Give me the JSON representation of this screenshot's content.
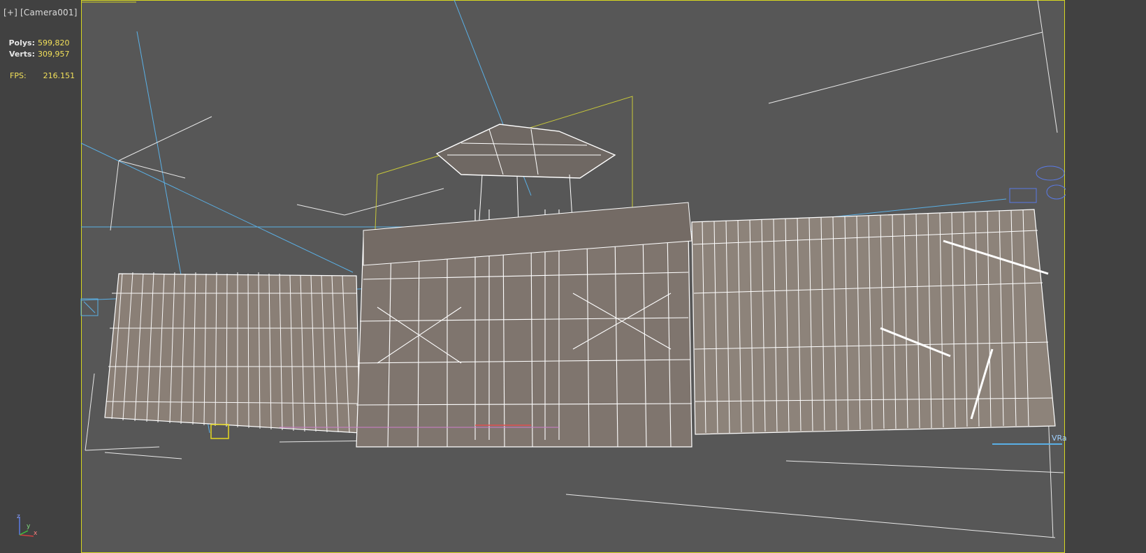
{
  "viewport": {
    "label_plus": "[+]",
    "label_camera": "[Camera001]",
    "renderer_tag": "VRa",
    "background_color": "#414141",
    "render_area_color": "#575757",
    "safe_frame_color": "#d8d820",
    "wire_color": "#ffffff",
    "helper_color": "#5ab0e6"
  },
  "stats": {
    "polys_label": "Polys:",
    "polys_value": "599,820",
    "verts_label": "Verts:",
    "verts_value": "309,957",
    "fps_label": "FPS:",
    "fps_value": "216.151"
  },
  "gizmo": {
    "x_label": "x",
    "y_label": "y",
    "z_label": "z"
  }
}
